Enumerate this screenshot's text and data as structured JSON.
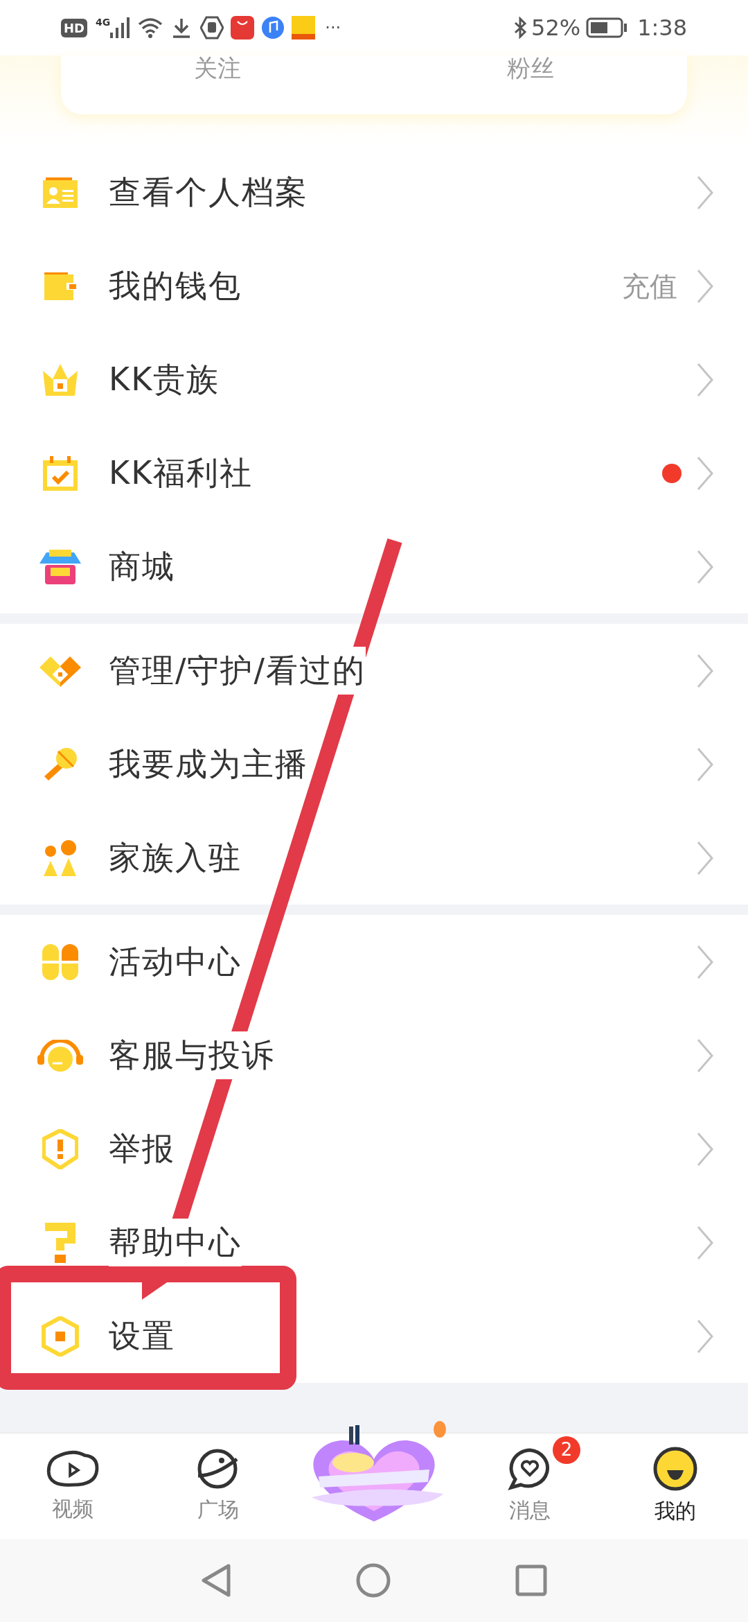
{
  "status_bar": {
    "left_badges": [
      "HD",
      "4G"
    ],
    "more": "···",
    "battery": "52%",
    "time": "1:38"
  },
  "profile_card": {
    "stats": [
      "关注",
      "粉丝"
    ]
  },
  "menu_groups": [
    {
      "items": [
        {
          "label": "查看个人档案"
        },
        {
          "label": "我的钱包",
          "value": "充值"
        },
        {
          "label": "KK贵族"
        },
        {
          "label": "KK福利社",
          "dot": true
        },
        {
          "label": "商城"
        }
      ]
    },
    {
      "items": [
        {
          "label": "管理/守护/看过的"
        },
        {
          "label": "我要成为主播"
        },
        {
          "label": "家族入驻"
        }
      ]
    },
    {
      "items": [
        {
          "label": "活动中心"
        },
        {
          "label": "客服与投诉"
        },
        {
          "label": "举报"
        },
        {
          "label": "帮助中心"
        },
        {
          "label": "设置"
        }
      ]
    }
  ],
  "bottom_nav": [
    {
      "label": "视频",
      "selected": false
    },
    {
      "label": "广场",
      "selected": false
    },
    {
      "kind": "picture"
    },
    {
      "label": "消息",
      "selected": false,
      "badge": "2"
    },
    {
      "label": "我的",
      "selected": true
    }
  ]
}
